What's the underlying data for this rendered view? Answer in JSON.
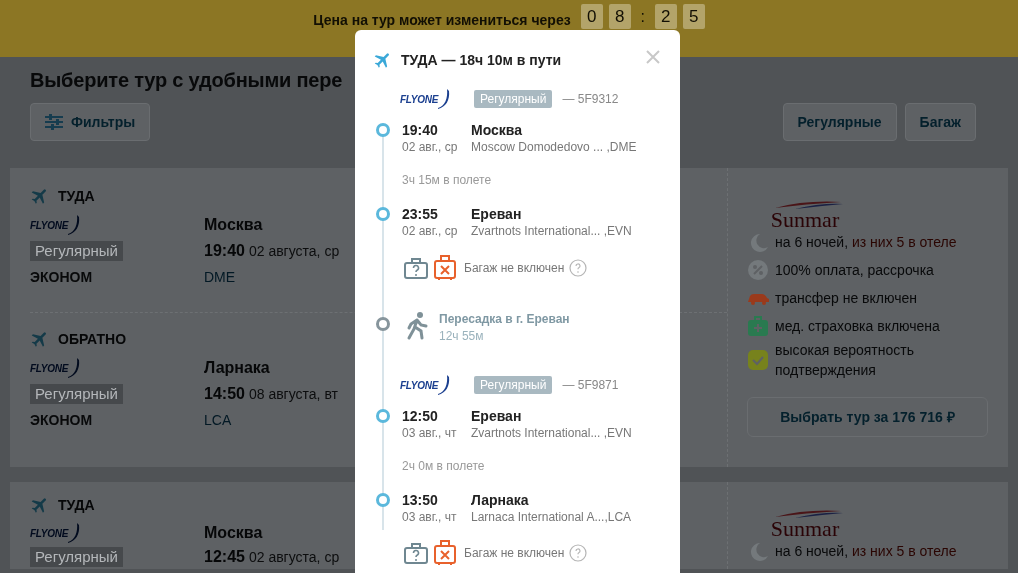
{
  "price_timer": {
    "label": "Цена на тур может измениться через",
    "digits": [
      "0",
      "8",
      "2",
      "5"
    ],
    "separator": ":"
  },
  "page_title": "Выберите тур с удобными пере",
  "filters_button": "Фильтры",
  "filter_chips": [
    "Регулярные",
    "Багаж"
  ],
  "tours": [
    {
      "segments": [
        {
          "direction": "ТУДА",
          "airline": "FLYONE",
          "flight_type": "Регулярный",
          "cabin": "ЭКОНОМ",
          "city": "Москва",
          "time": "19:40",
          "date": "02 августа, ср",
          "airport": "DME"
        },
        {
          "direction": "ОБРАТНО",
          "airline": "FLYONE",
          "flight_type": "Регулярный",
          "cabin": "ЭКОНОМ",
          "city": "Ларнака",
          "time": "14:50",
          "date": "08 августа, вт",
          "airport": "LCA"
        }
      ],
      "operator": "Sunmar",
      "features": [
        {
          "kind": "nights",
          "text": "на 6 ночей, ",
          "highlight": "из них 5 в отеле"
        },
        {
          "kind": "payment",
          "text": "100% оплата, рассрочка"
        },
        {
          "kind": "transfer",
          "text": "трансфер не включен"
        },
        {
          "kind": "insurance",
          "text": "мед. страховка включена"
        },
        {
          "kind": "confirmation",
          "text": "высокая вероятность подтверждения"
        }
      ],
      "select_button": "Выбрать тур за 176 716 ₽"
    },
    {
      "segments": [
        {
          "direction": "ТУДА",
          "airline": "FLYONE",
          "flight_type": "Регулярный",
          "city": "Москва",
          "time": "12:45",
          "date": "02 августа, ср"
        }
      ],
      "operator": "Sunmar",
      "features": [
        {
          "kind": "nights",
          "text": "на 6 ночей, ",
          "highlight": "из них 5 в отеле"
        }
      ]
    }
  ],
  "modal": {
    "title": "ТУДА — 18ч 10м в пути",
    "items": [
      {
        "kind": "flight",
        "airline": "FLYONE",
        "flight_type": "Регулярный",
        "flight_number": "— 5F9312",
        "departure": {
          "time": "19:40",
          "date": "02 авг., ср",
          "city": "Москва",
          "airport": "Moscow Domodedovo ... ,DME"
        },
        "duration": "3ч 15м в полете",
        "arrival": {
          "time": "23:55",
          "date": "02 авг., ср",
          "city": "Ереван",
          "airport": "Zvartnots International... ,EVN"
        },
        "baggage": "Багаж не включен"
      },
      {
        "kind": "transfer",
        "text": "Пересадка в г. Ереван",
        "duration": "12ч 55м"
      },
      {
        "kind": "flight",
        "airline": "FLYONE",
        "flight_type": "Регулярный",
        "flight_number": "— 5F9871",
        "departure": {
          "time": "12:50",
          "date": "03 авг., чт",
          "city": "Ереван",
          "airport": "Zvartnots International... ,EVN"
        },
        "duration": "2ч 0м в полете",
        "arrival": {
          "time": "13:50",
          "date": "03 авг., чт",
          "city": "Ларнака",
          "airport": "Larnaca International A...,LCA"
        },
        "baggage": "Багаж не включен"
      }
    ]
  }
}
